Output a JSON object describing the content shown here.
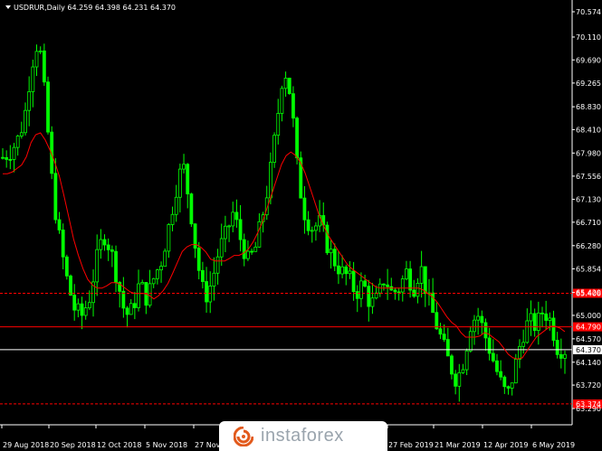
{
  "header": {
    "symbol_line": "USDRUR,Daily  64.259 64.398 64.231 64.370"
  },
  "colors": {
    "background": "#000000",
    "candle": "#00ff00",
    "ma_line": "#ff0000",
    "text": "#ffffff"
  },
  "watermark": {
    "text": "instaforex"
  },
  "chart_data": {
    "type": "line",
    "description_of_series": "daily candlesticks plus moving average",
    "ylim": [
      63.29,
      70.574
    ],
    "y_ticks": [
      "70.574",
      "70.110",
      "69.690",
      "69.265",
      "68.830",
      "68.410",
      "67.980",
      "67.556",
      "67.130",
      "66.710",
      "66.280",
      "65.854",
      "65.420",
      "65.000",
      "64.570",
      "64.140",
      "63.720",
      "63.290"
    ],
    "x_ticks": [
      "29 Aug 2018",
      "20 Sep 2018",
      "12 Oct 2018",
      "5 Nov 2018",
      "27 Nov",
      "27 Feb 2019",
      "21 Mar 2019",
      "12 Apr 2019",
      "6 May 2019"
    ],
    "horizontal_lines": [
      {
        "label": "65.406",
        "value": 65.406,
        "style": "dashed",
        "color": "#ff0000"
      },
      {
        "label": "64.790",
        "value": 64.79,
        "style": "solid",
        "color": "#ff0000"
      },
      {
        "label": "64.370",
        "value": 64.37,
        "style": "solid",
        "color": "#ffffff"
      },
      {
        "label": "63.374",
        "value": 63.374,
        "style": "dashed",
        "color": "#ff0000"
      }
    ],
    "close_series": [
      67.9,
      68.0,
      68.2,
      68.6,
      69.6,
      70.1,
      68.8,
      67.2,
      66.3,
      65.6,
      65.1,
      65.0,
      65.3,
      66.0,
      66.5,
      66.2,
      65.6,
      65.0,
      65.1,
      65.6,
      65.3,
      65.7,
      66.0,
      66.6,
      67.3,
      67.8,
      67.0,
      66.0,
      65.3,
      65.6,
      66.2,
      66.5,
      66.9,
      66.4,
      66.0,
      66.2,
      66.8,
      67.5,
      68.5,
      69.6,
      69.0,
      67.5,
      66.8,
      66.6,
      66.7,
      66.3,
      66.0,
      65.8,
      65.7,
      65.4,
      65.6,
      65.2,
      65.3,
      65.7,
      65.4,
      65.5,
      65.8,
      65.5,
      65.9,
      65.3,
      64.9,
      64.5,
      64.1,
      63.8,
      64.2,
      64.9,
      65.0,
      64.6,
      64.2,
      63.8,
      63.5,
      64.0,
      64.6,
      64.9,
      64.8,
      65.1,
      64.9,
      64.4,
      64.37
    ],
    "ma_series": [
      67.6,
      67.6,
      67.7,
      67.8,
      68.2,
      68.4,
      68.2,
      67.9,
      67.5,
      66.9,
      66.3,
      65.9,
      65.6,
      65.5,
      65.5,
      65.6,
      65.6,
      65.5,
      65.4,
      65.4,
      65.4,
      65.3,
      65.4,
      65.6,
      65.9,
      66.2,
      66.3,
      66.3,
      66.2,
      66.0,
      66.0,
      66.0,
      66.1,
      66.1,
      66.2,
      66.4,
      66.7,
      67.1,
      67.5,
      67.9,
      68.0,
      67.9,
      67.6,
      67.2,
      66.8,
      66.5,
      66.3,
      66.1,
      65.9,
      65.8,
      65.7,
      65.6,
      65.5,
      65.5,
      65.5,
      65.5,
      65.5,
      65.5,
      65.5,
      65.4,
      65.3,
      65.1,
      64.9,
      64.8,
      64.6,
      64.6,
      64.6,
      64.7,
      64.6,
      64.5,
      64.3,
      64.2,
      64.2,
      64.4,
      64.6,
      64.7,
      64.8,
      64.8,
      64.7
    ]
  }
}
